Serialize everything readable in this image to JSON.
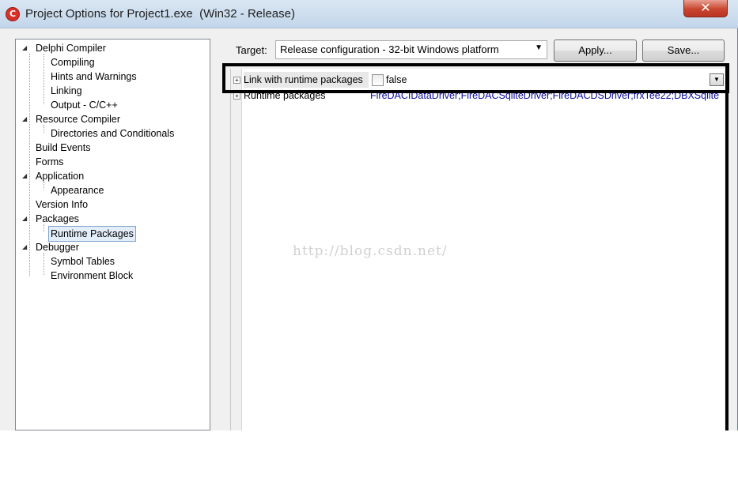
{
  "window": {
    "title": "Project Options for Project1.exe  (Win32 - Release)",
    "app_icon_glyph": "C",
    "close_glyph": "✕"
  },
  "tree": {
    "items": [
      {
        "label": "Delphi Compiler",
        "level": 0,
        "expanded": true
      },
      {
        "label": "Compiling",
        "level": 1
      },
      {
        "label": "Hints and Warnings",
        "level": 1
      },
      {
        "label": "Linking",
        "level": 1
      },
      {
        "label": "Output - C/C++",
        "level": 1
      },
      {
        "label": "Resource Compiler",
        "level": 0,
        "expanded": true
      },
      {
        "label": "Directories and Conditionals",
        "level": 1
      },
      {
        "label": "Build Events",
        "level": 0
      },
      {
        "label": "Forms",
        "level": 0
      },
      {
        "label": "Application",
        "level": 0,
        "expanded": true
      },
      {
        "label": "Appearance",
        "level": 1
      },
      {
        "label": "Version Info",
        "level": 0
      },
      {
        "label": "Packages",
        "level": 0,
        "expanded": true
      },
      {
        "label": "Runtime Packages",
        "level": 1,
        "selected": true
      },
      {
        "label": "Debugger",
        "level": 0,
        "expanded": true
      },
      {
        "label": "Symbol Tables",
        "level": 1
      },
      {
        "label": "Environment Block",
        "level": 1
      }
    ]
  },
  "target": {
    "label": "Target:",
    "value": "Release configuration - 32-bit Windows platform"
  },
  "buttons": {
    "apply": "Apply...",
    "save": "Save..."
  },
  "grid": {
    "rows": [
      {
        "name": "Link with runtime packages",
        "value": "false",
        "checked": false
      },
      {
        "name": "Runtime packages",
        "value": "FireDACIDataDriver;FireDACSqliteDriver;FireDACDSDriver;frxTee22;DBXSqlite"
      }
    ]
  },
  "watermark": "http://blog.csdn.net/"
}
